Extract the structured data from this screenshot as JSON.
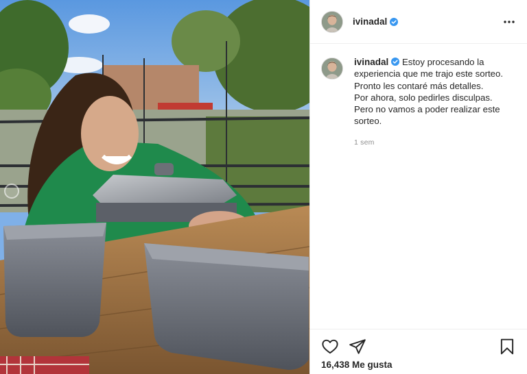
{
  "post": {
    "username": "ivinadal",
    "verified": true,
    "caption": "Estoy procesando la experiencia que me trajo este sorteo.\nPronto les contaré más detalles.\nPor ahora, solo pedirles disculpas.\nPero no vamos a poder realizar este sorteo.",
    "timestamp": "1 sem",
    "likes": "16,438 Me gusta"
  },
  "icons": {
    "more": "more-options-icon",
    "like": "heart-icon",
    "share": "paper-plane-icon",
    "save": "bookmark-icon",
    "verified": "verified-badge-icon"
  },
  "colors": {
    "verified_blue": "#3897f0",
    "divider": "#efefef",
    "muted_text": "#8e8e8e"
  }
}
